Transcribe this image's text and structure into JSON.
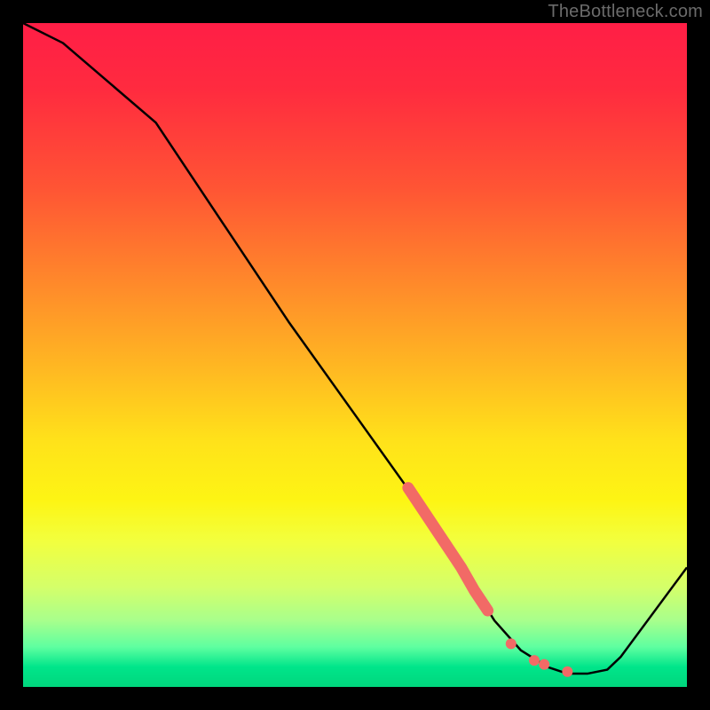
{
  "watermark": "TheBottleneck.com",
  "chart_data": {
    "type": "line",
    "title": "",
    "xlabel": "",
    "ylabel": "",
    "xlim": [
      0,
      100
    ],
    "ylim": [
      0,
      100
    ],
    "series": [
      {
        "name": "curve",
        "x": [
          0,
          6,
          20,
          30,
          40,
          50,
          60,
          66,
          71,
          75,
          79,
          82,
          85,
          88,
          90,
          100
        ],
        "values": [
          100,
          97,
          85,
          70,
          55,
          41,
          27,
          18,
          10,
          5.5,
          3.0,
          2.0,
          2.0,
          2.6,
          4.5,
          18
        ]
      }
    ],
    "highlight_segment": {
      "name": "thick-pink-segment",
      "color": "#f26a66",
      "x": [
        58,
        60,
        62,
        64,
        66,
        68,
        70
      ],
      "values": [
        30,
        27,
        24,
        21,
        18,
        14.5,
        11.5
      ]
    },
    "highlight_dots": {
      "name": "pink-dots",
      "color": "#f26a66",
      "points": [
        {
          "x": 73.5,
          "y": 6.5
        },
        {
          "x": 77,
          "y": 4.0
        },
        {
          "x": 78.5,
          "y": 3.4
        },
        {
          "x": 82,
          "y": 2.3
        }
      ]
    }
  }
}
